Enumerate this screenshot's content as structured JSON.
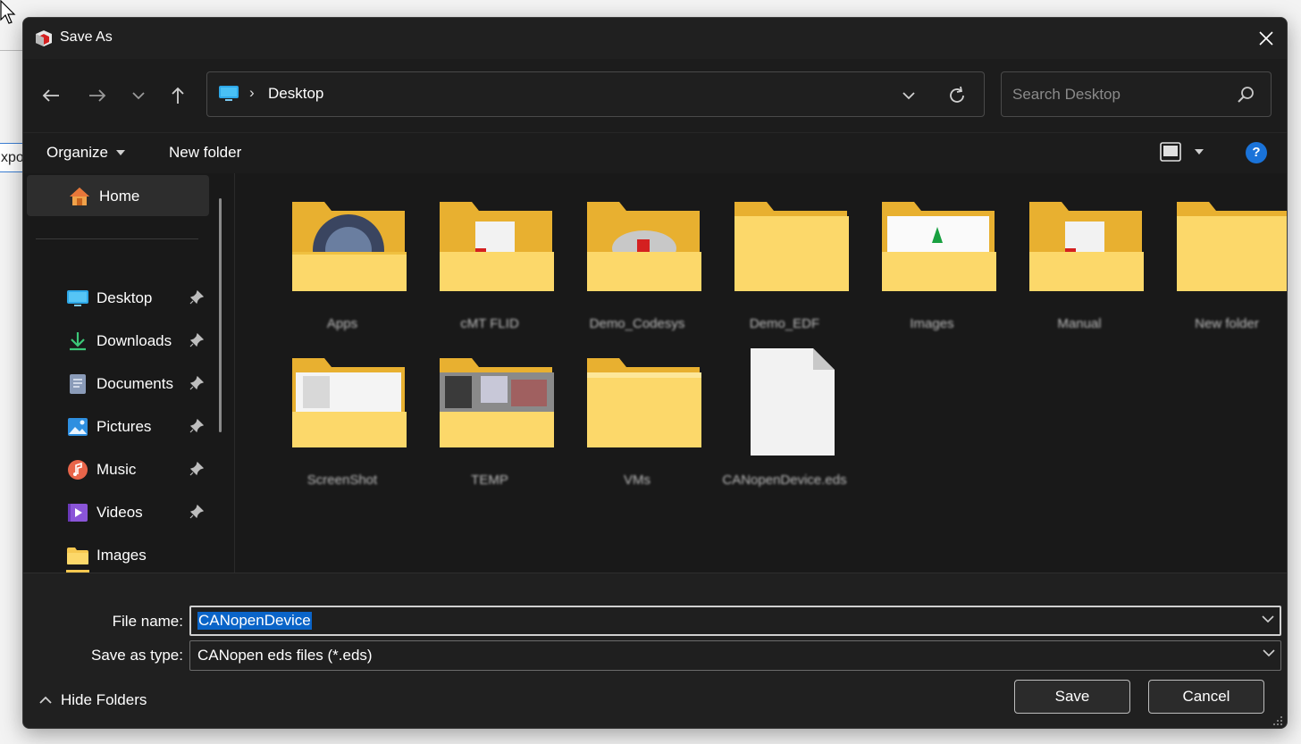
{
  "background": {
    "partial_text": "xpo"
  },
  "window": {
    "title": "Save As",
    "close_glyph": "✕"
  },
  "navigation": {
    "back_icon": "arrow-left-icon",
    "forward_icon": "arrow-right-icon",
    "recent_icon": "chevron-down-icon",
    "up_icon": "arrow-up-icon"
  },
  "address_bar": {
    "separator": "›",
    "location": "Desktop"
  },
  "search": {
    "placeholder": "Search Desktop"
  },
  "command_bar": {
    "organize_label": "Organize",
    "new_folder_label": "New folder",
    "help_glyph": "?"
  },
  "sidebar": {
    "home_label": "Home",
    "items": [
      {
        "label": "Desktop",
        "icon": "desktop-icon",
        "pinned": true
      },
      {
        "label": "Downloads",
        "icon": "download-icon",
        "pinned": true
      },
      {
        "label": "Documents",
        "icon": "document-icon",
        "pinned": true
      },
      {
        "label": "Pictures",
        "icon": "pictures-icon",
        "pinned": true
      },
      {
        "label": "Music",
        "icon": "music-icon",
        "pinned": true
      },
      {
        "label": "Videos",
        "icon": "video-icon",
        "pinned": true
      },
      {
        "label": "Images",
        "icon": "folder-icon",
        "pinned": false
      }
    ]
  },
  "files": [
    {
      "name": "Apps",
      "type": "folder"
    },
    {
      "name": "cMT FLID",
      "type": "folder"
    },
    {
      "name": "Demo_Codesys",
      "type": "folder"
    },
    {
      "name": "Demo_EDF",
      "type": "folder"
    },
    {
      "name": "Images",
      "type": "folder"
    },
    {
      "name": "Manual",
      "type": "folder"
    },
    {
      "name": "New folder",
      "type": "folder"
    },
    {
      "name": "ScreenShot",
      "type": "folder"
    },
    {
      "name": "TEMP",
      "type": "folder"
    },
    {
      "name": "VMs",
      "type": "folder"
    },
    {
      "name": "CANopenDevice.eds",
      "type": "file"
    }
  ],
  "form": {
    "file_name_label": "File name:",
    "file_name_value": "CANopenDevice",
    "save_type_label": "Save as type:",
    "save_type_value": "CANopen eds files (*.eds)"
  },
  "footer": {
    "hide_folders_label": "Hide Folders",
    "save_label": "Save",
    "cancel_label": "Cancel"
  },
  "colors": {
    "dialog_bg": "#1c1c1c",
    "accent": "#0a64c8",
    "folder_yellow": "#f6c850",
    "help_blue": "#1a73d9"
  }
}
